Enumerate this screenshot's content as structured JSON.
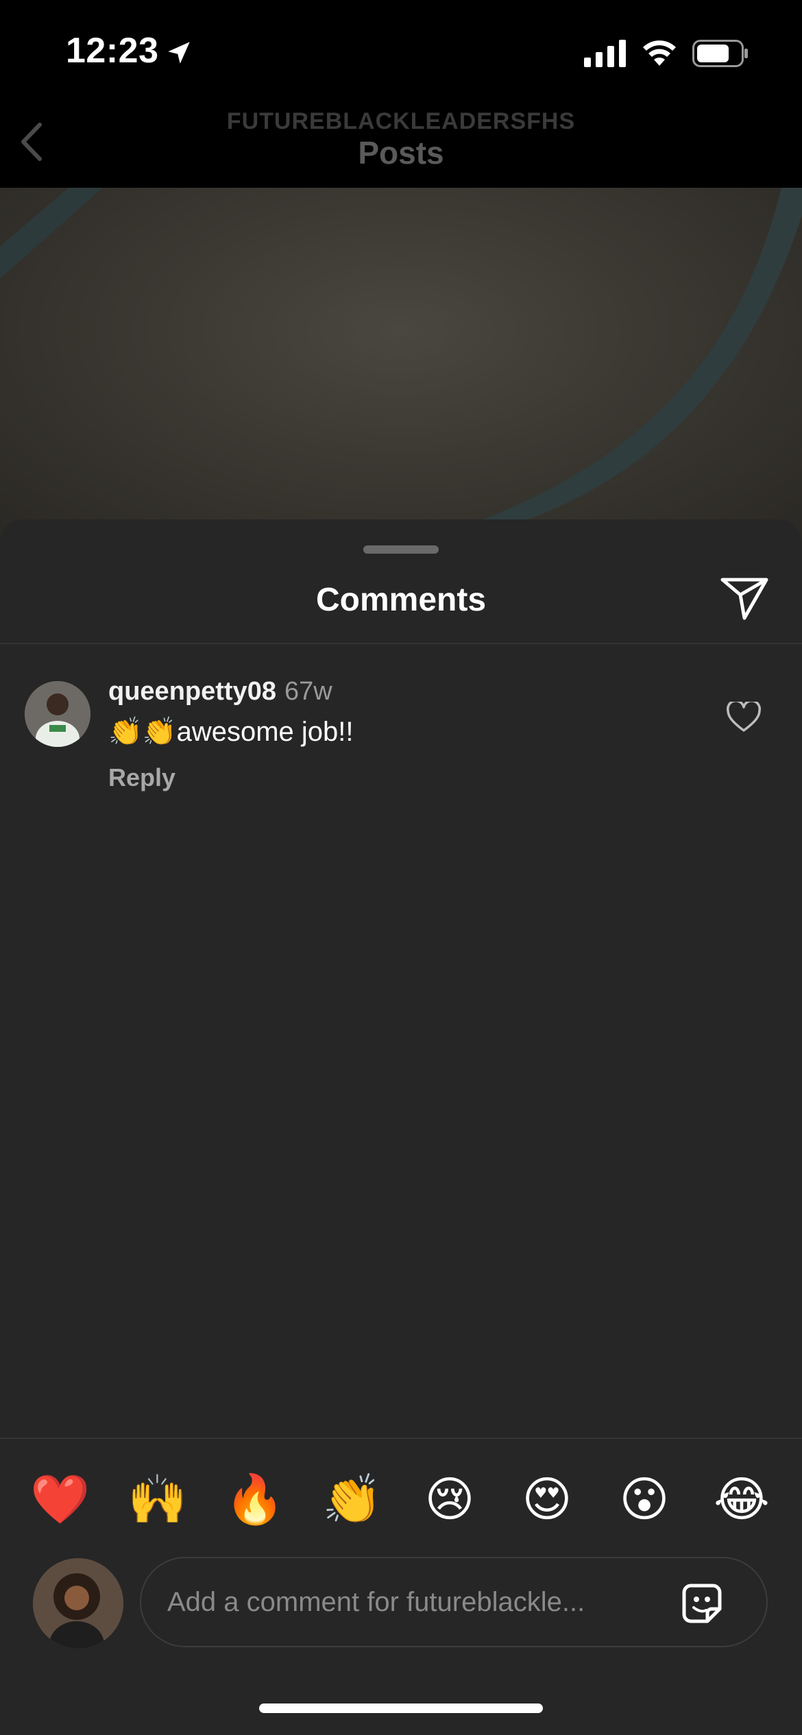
{
  "status_bar": {
    "time": "12:23"
  },
  "nav": {
    "subtitle": "FUTUREBLACKLEADERSFHS",
    "title": "Posts"
  },
  "sheet": {
    "title": "Comments",
    "comments": [
      {
        "username": "queenpetty08",
        "time": "67w",
        "text": "👏👏awesome job!!",
        "reply_label": "Reply"
      }
    ]
  },
  "reactions": [
    "❤️",
    "🙌",
    "🔥",
    "👏",
    "😢",
    "😍",
    "😮",
    "😂"
  ],
  "composer": {
    "placeholder": "Add a comment for futureblackle..."
  },
  "colors": {
    "background": "#000000",
    "sheet": "#262626",
    "muted": "#8a8a8a"
  }
}
